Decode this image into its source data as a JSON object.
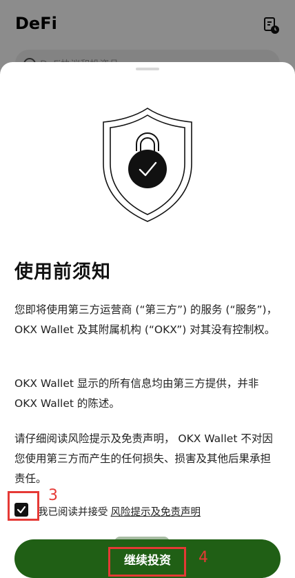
{
  "background": {
    "title": "DeFi",
    "search_placeholder": "DeFi协议和投资品"
  },
  "sheet": {
    "title": "使用前须知",
    "paragraph1": "您即将使用第三方运营商 (“第三方”) 的服务 (“服务”)，OKX Wallet 及其附属机构 (“OKX”) 对其没有控制权。",
    "paragraph2": "OKX Wallet 显示的所有信息均由第三方提供，并非 OKX Wallet 的陈述。",
    "paragraph3": "请仔细阅读风险提示及免责声明， OKX Wallet 不对因您使用第三方而产生的任何损失、损害及其他后果承担责任。",
    "agree_text": "我已阅读并接受",
    "agree_link": "风险提示及免责声明",
    "agree_checked": true,
    "continue_label": "继续投资"
  },
  "annotations": {
    "marker_checkbox": "3",
    "marker_button": "4",
    "color": "#e53935"
  },
  "colors": {
    "primary_button": "#205f15",
    "overlay": "rgba(0,0,0,0.45)"
  },
  "icons": {
    "shield": "shield-check-icon",
    "history": "history-icon",
    "checkbox": "checkmark-icon"
  }
}
